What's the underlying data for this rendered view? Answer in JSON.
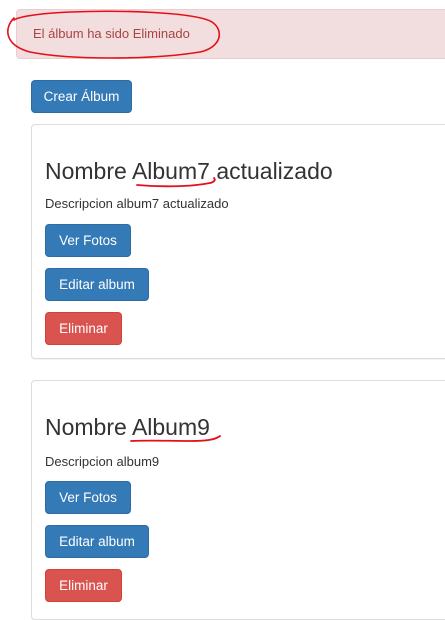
{
  "alert": {
    "message": "El álbum ha sido Eliminado",
    "color": "#a94442",
    "background": "#f2dede"
  },
  "toolbar": {
    "create_label": "Crear Álbum"
  },
  "albums": [
    {
      "title_prefix": "Nombre",
      "title_name": "Album7",
      "title_suffix": "actualizado",
      "description": "Descripcion album7 actualizado",
      "view_label": "Ver Fotos",
      "edit_label": "Editar album",
      "delete_label": "Eliminar"
    },
    {
      "title_prefix": "Nombre",
      "title_name": "Album9",
      "title_suffix": "",
      "description": "Descripcion album9",
      "view_label": "Ver Fotos",
      "edit_label": "Editar album",
      "delete_label": "Eliminar"
    }
  ],
  "colors": {
    "primary": "#337ab7",
    "danger": "#d9534f",
    "annotation": "#e3101a"
  }
}
